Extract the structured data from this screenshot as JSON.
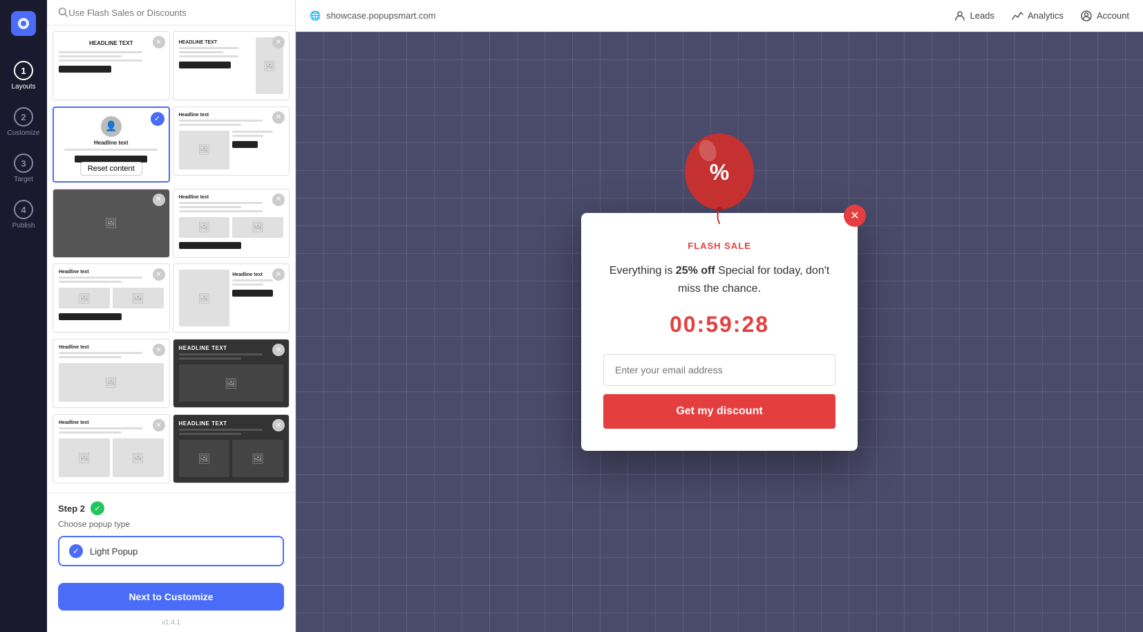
{
  "sidebar": {
    "steps": [
      {
        "number": "1",
        "label": "Layouts",
        "active": true
      },
      {
        "number": "2",
        "label": "Customize",
        "active": false
      },
      {
        "number": "3",
        "label": "Target",
        "active": false
      },
      {
        "number": "4",
        "label": "Publish",
        "active": false
      }
    ]
  },
  "panel": {
    "search_placeholder": "Use Flash Sales or Discounts",
    "template_cards": [
      {
        "id": "t1",
        "selected": false,
        "dark": false
      },
      {
        "id": "t2",
        "selected": false,
        "dark": false
      },
      {
        "id": "t3",
        "selected": true,
        "has_reset": true
      },
      {
        "id": "t4",
        "selected": false,
        "dark": false
      },
      {
        "id": "t5",
        "selected": false,
        "dark": true
      },
      {
        "id": "t6",
        "selected": false,
        "dark": false
      },
      {
        "id": "t7",
        "selected": false,
        "dark": false
      },
      {
        "id": "t8",
        "selected": false,
        "dark": false
      },
      {
        "id": "t9",
        "selected": false,
        "dark": false
      },
      {
        "id": "t10",
        "selected": false,
        "dark": true
      },
      {
        "id": "t11",
        "selected": false,
        "dark": false
      },
      {
        "id": "t12",
        "selected": false,
        "dark": true
      }
    ],
    "reset_button_label": "Reset content",
    "step2_label": "Step 2",
    "step2_sublabel": "Choose popup type",
    "popup_type_label": "Light Popup",
    "next_button_label": "Next to Customize",
    "version": "v1.4.1"
  },
  "topbar": {
    "url": "showcase.popupsmart.com",
    "leads_label": "Leads",
    "analytics_label": "Analytics",
    "account_label": "Account"
  },
  "popup": {
    "close_button_aria": "Close",
    "flash_sale_label": "FLASH SALE",
    "description_before": "Everything is ",
    "description_bold": "25% off",
    "description_after": " Special for today, don't miss the chance.",
    "countdown": "00:59:28",
    "email_placeholder": "Enter your email address",
    "discount_button_label": "Get my discount"
  }
}
